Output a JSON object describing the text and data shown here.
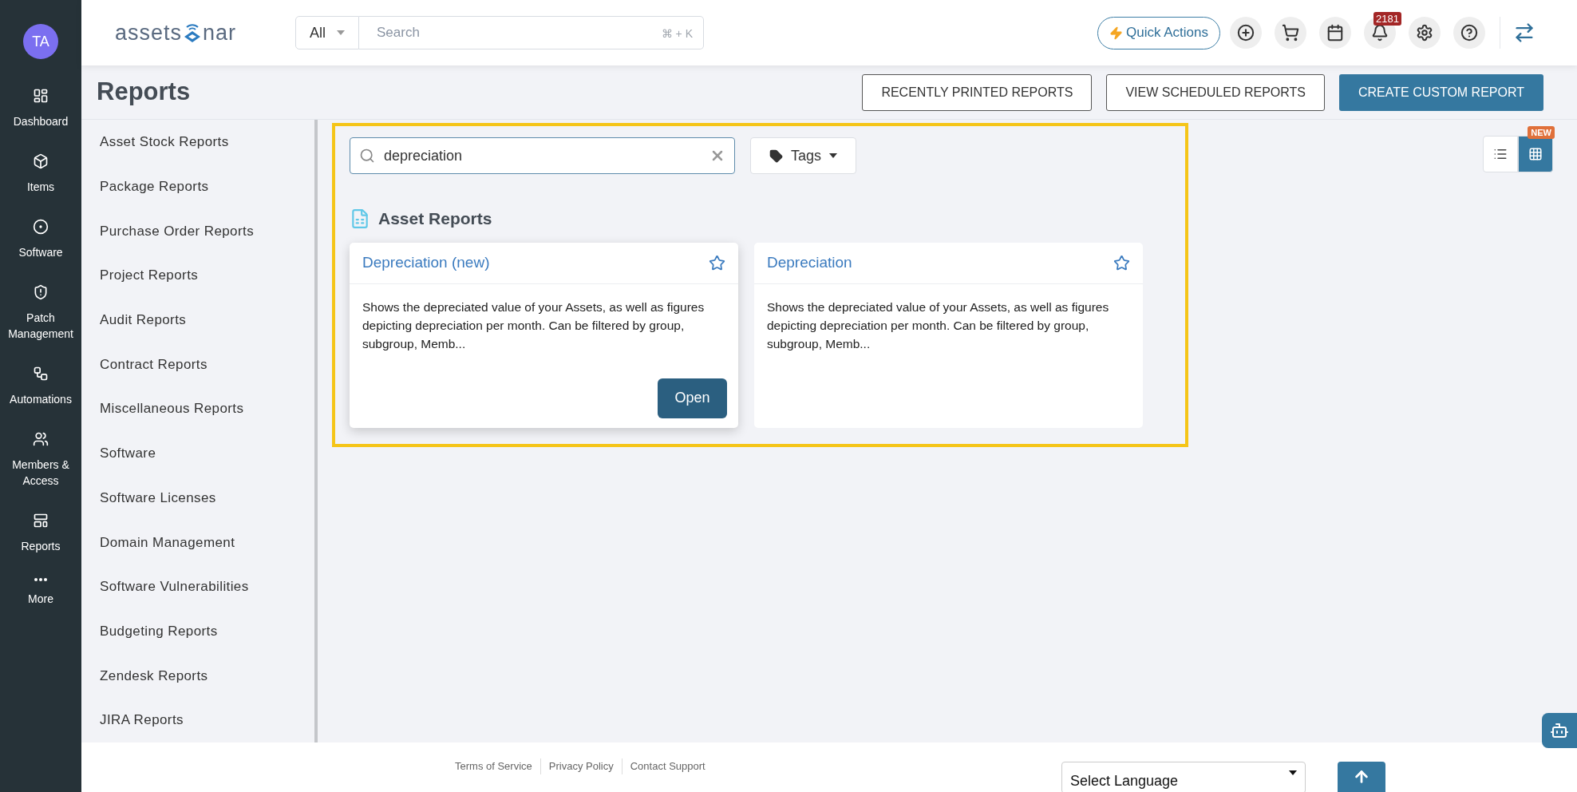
{
  "user": {
    "initials": "TA"
  },
  "logo": {
    "left": "assets",
    "right": "nar"
  },
  "search": {
    "scope": "All",
    "placeholder": "Search",
    "shortcut": "⌘ + K"
  },
  "quick_actions": "Quick Actions",
  "notifications": {
    "count": "2181"
  },
  "nav": [
    {
      "label": "Dashboard",
      "kind": "dashboard"
    },
    {
      "label": "Items",
      "kind": "items"
    },
    {
      "label": "Software",
      "kind": "software"
    },
    {
      "label": "Patch Management",
      "kind": "patch"
    },
    {
      "label": "Automations",
      "kind": "automations"
    },
    {
      "label": "Members & Access",
      "kind": "members"
    },
    {
      "label": "Reports",
      "kind": "reports"
    },
    {
      "label": "More",
      "kind": "more"
    }
  ],
  "page_title": "Reports",
  "header_buttons": [
    {
      "label": "RECENTLY PRINTED REPORTS",
      "kind": "outline"
    },
    {
      "label": "VIEW SCHEDULED REPORTS",
      "kind": "outline"
    },
    {
      "label": "CREATE CUSTOM REPORT",
      "kind": "primary"
    }
  ],
  "categories": [
    "Asset Stock Reports",
    "Package Reports",
    "Purchase Order Reports",
    "Project Reports",
    "Audit Reports",
    "Contract Reports",
    "Miscellaneous Reports",
    "Software",
    "Software Licenses",
    "Domain Management",
    "Software Vulnerabilities",
    "Budgeting Reports",
    "Zendesk Reports",
    "JIRA Reports"
  ],
  "report_search": {
    "value": "depreciation"
  },
  "tags_button": "Tags",
  "view_toggle": {
    "new_badge": "NEW",
    "views": [
      {
        "kind": "list",
        "selected": false
      },
      {
        "kind": "grid",
        "selected": true
      }
    ]
  },
  "section": {
    "title": "Asset Reports",
    "cards": [
      {
        "title": "Depreciation (new)",
        "description": "Shows the depreciated value of your Assets, as well as figures depicting depreciation per month. Can be filtered by group, subgroup, Memb...",
        "hovered": true,
        "action": "Open"
      },
      {
        "title": "Depreciation",
        "description": "Shows the depreciated value of your Assets, as well as figures depicting depreciation per month. Can be filtered by group, subgroup, Memb...",
        "hovered": false
      }
    ]
  },
  "footer": {
    "links": [
      "Terms of Service",
      "Privacy Policy",
      "Contact Support"
    ],
    "language": "Select Language"
  }
}
